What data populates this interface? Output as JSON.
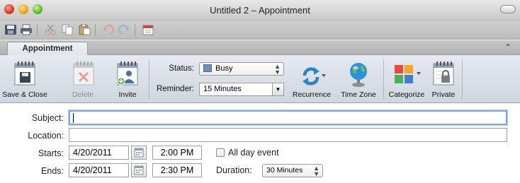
{
  "window": {
    "title": "Untitled 2 – Appointment"
  },
  "quick_toolbar": {
    "icons": [
      "save-icon",
      "print-icon",
      "cut-icon",
      "copy-icon",
      "paste-icon",
      "undo-icon",
      "redo-icon",
      "calendar-icon"
    ]
  },
  "ribbon": {
    "tab": "Appointment",
    "buttons": {
      "save_close": "Save & Close",
      "delete": "Delete",
      "invite": "Invite",
      "recurrence": "Recurrence",
      "time_zone": "Time Zone",
      "categorize": "Categorize",
      "private": "Private"
    },
    "status_label": "Status:",
    "status_value": "Busy",
    "status_color": "#6f8fb8",
    "reminder_label": "Reminder:",
    "reminder_value": "15 Minutes"
  },
  "form": {
    "subject_label": "Subject:",
    "subject_value": "",
    "location_label": "Location:",
    "location_value": "",
    "starts_label": "Starts:",
    "start_date": "4/20/2011",
    "start_time": "2:00 PM",
    "all_day_label": "All day event",
    "all_day_checked": false,
    "ends_label": "Ends:",
    "end_date": "4/20/2011",
    "end_time": "2:30 PM",
    "duration_label": "Duration:",
    "duration_value": "30 Minutes"
  },
  "colors": {
    "focus_ring": "#7aa7dd",
    "ribbon_bg": "#dde2e9"
  }
}
